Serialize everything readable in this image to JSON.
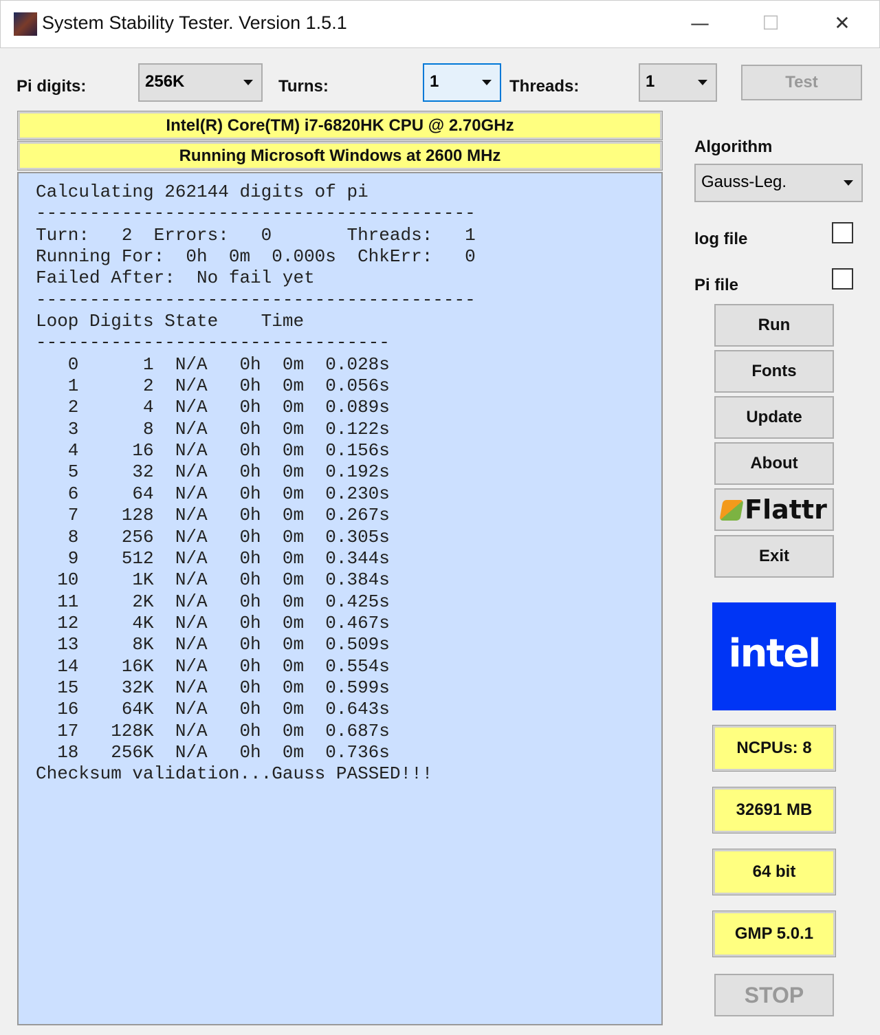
{
  "window": {
    "title": "System Stability Tester. Version 1.5.1",
    "minimize": "—",
    "maximize": "☐",
    "close": "✕"
  },
  "toolbar": {
    "pi_digits_label": "Pi digits:",
    "pi_digits_value": "256K",
    "turns_label": "Turns:",
    "turns_value": "1",
    "threads_label": "Threads:",
    "threads_value": "1",
    "test_label": "Test"
  },
  "cpu_banner": "Intel(R) Core(TM) i7-6820HK CPU @ 2.70GHz",
  "os_banner": "Running Microsoft Windows at 2600 MHz",
  "console": {
    "header": "Calculating 262144 digits of pi",
    "turn": "2",
    "errors": "0",
    "threads": "1",
    "running_for": "0h  0m  0.000s",
    "chkerr": "0",
    "failed_after": "No fail yet",
    "labels": {
      "turn": "Turn:",
      "errors": "Errors:",
      "threads": "Threads:",
      "running_for": "Running For:",
      "chkerr": "ChkErr:",
      "failed_after": "Failed After:",
      "loop": "Loop",
      "digits": "Digits",
      "state": "State",
      "time": "Time"
    },
    "rows": [
      [
        "0",
        "1",
        "N/A",
        "0h",
        "0m",
        "0.028s"
      ],
      [
        "1",
        "2",
        "N/A",
        "0h",
        "0m",
        "0.056s"
      ],
      [
        "2",
        "4",
        "N/A",
        "0h",
        "0m",
        "0.089s"
      ],
      [
        "3",
        "8",
        "N/A",
        "0h",
        "0m",
        "0.122s"
      ],
      [
        "4",
        "16",
        "N/A",
        "0h",
        "0m",
        "0.156s"
      ],
      [
        "5",
        "32",
        "N/A",
        "0h",
        "0m",
        "0.192s"
      ],
      [
        "6",
        "64",
        "N/A",
        "0h",
        "0m",
        "0.230s"
      ],
      [
        "7",
        "128",
        "N/A",
        "0h",
        "0m",
        "0.267s"
      ],
      [
        "8",
        "256",
        "N/A",
        "0h",
        "0m",
        "0.305s"
      ],
      [
        "9",
        "512",
        "N/A",
        "0h",
        "0m",
        "0.344s"
      ],
      [
        "10",
        "1K",
        "N/A",
        "0h",
        "0m",
        "0.384s"
      ],
      [
        "11",
        "2K",
        "N/A",
        "0h",
        "0m",
        "0.425s"
      ],
      [
        "12",
        "4K",
        "N/A",
        "0h",
        "0m",
        "0.467s"
      ],
      [
        "13",
        "8K",
        "N/A",
        "0h",
        "0m",
        "0.509s"
      ],
      [
        "14",
        "16K",
        "N/A",
        "0h",
        "0m",
        "0.554s"
      ],
      [
        "15",
        "32K",
        "N/A",
        "0h",
        "0m",
        "0.599s"
      ],
      [
        "16",
        "64K",
        "N/A",
        "0h",
        "0m",
        "0.643s"
      ],
      [
        "17",
        "128K",
        "N/A",
        "0h",
        "0m",
        "0.687s"
      ],
      [
        "18",
        "256K",
        "N/A",
        "0h",
        "0m",
        "0.736s"
      ]
    ],
    "footer": "Checksum validation...Gauss PASSED!!!"
  },
  "side": {
    "algorithm_label": "Algorithm",
    "algorithm_value": "Gauss-Leg.",
    "log_file_label": "log file",
    "pi_file_label": "Pi file",
    "run": "Run",
    "fonts": "Fonts",
    "update": "Update",
    "about": "About",
    "flattr": "Flattr",
    "exit": "Exit",
    "intel_logo": "intel",
    "ncpus": "NCPUs: 8",
    "memory": "32691 MB",
    "bits": "64 bit",
    "gmp": "GMP 5.0.1",
    "stop": "STOP"
  }
}
